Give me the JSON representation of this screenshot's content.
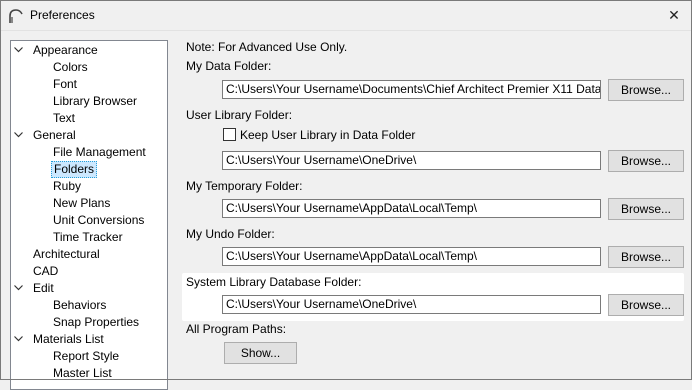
{
  "window": {
    "title": "Preferences",
    "close_glyph": "✕"
  },
  "tree": [
    {
      "label": "Appearance",
      "level": 0,
      "expanded": true
    },
    {
      "label": "Colors",
      "level": 1
    },
    {
      "label": "Font",
      "level": 1
    },
    {
      "label": "Library Browser",
      "level": 1
    },
    {
      "label": "Text",
      "level": 1
    },
    {
      "label": "General",
      "level": 0,
      "expanded": true
    },
    {
      "label": "File Management",
      "level": 1
    },
    {
      "label": "Folders",
      "level": 1,
      "selected": true
    },
    {
      "label": "Ruby",
      "level": 1
    },
    {
      "label": "New Plans",
      "level": 1
    },
    {
      "label": "Unit Conversions",
      "level": 1
    },
    {
      "label": "Time Tracker",
      "level": 1
    },
    {
      "label": "Architectural",
      "level": 0
    },
    {
      "label": "CAD",
      "level": 0
    },
    {
      "label": "Edit",
      "level": 0,
      "expanded": true
    },
    {
      "label": "Behaviors",
      "level": 1
    },
    {
      "label": "Snap Properties",
      "level": 1
    },
    {
      "label": "Materials List",
      "level": 0,
      "expanded": true
    },
    {
      "label": "Report Style",
      "level": 1
    },
    {
      "label": "Master List",
      "level": 1
    }
  ],
  "folders": {
    "note": "Note: For Advanced Use Only.",
    "data_folder_label": "My Data Folder:",
    "data_folder_path": "C:\\Users\\Your Username\\Documents\\Chief Architect Premier X11 Data\\",
    "user_library_label": "User Library Folder:",
    "keep_in_data_label": "Keep User Library in Data Folder",
    "keep_in_data_checked": false,
    "user_library_path": "C:\\Users\\Your Username\\OneDrive\\",
    "temp_folder_label": "My Temporary Folder:",
    "temp_folder_path": "C:\\Users\\Your Username\\AppData\\Local\\Temp\\",
    "undo_folder_label": "My Undo Folder:",
    "undo_folder_path": "C:\\Users\\Your Username\\AppData\\Local\\Temp\\",
    "system_db_label": "System Library Database Folder:",
    "system_db_path": "C:\\Users\\Your Username\\OneDrive\\",
    "all_paths_label": "All Program Paths:",
    "browse_label": "Browse...",
    "show_label": "Show..."
  }
}
